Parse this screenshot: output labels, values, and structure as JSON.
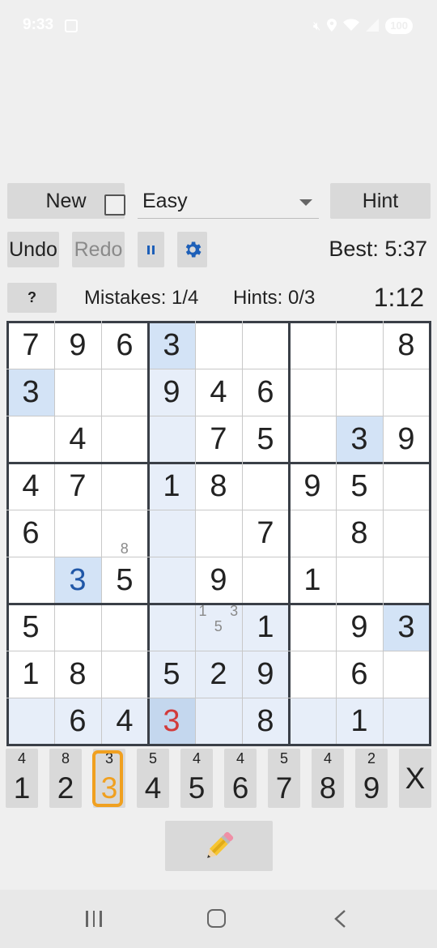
{
  "status_bar": {
    "time": "9:33",
    "battery": "100",
    "icons": [
      "screen-record-icon",
      "mute-icon",
      "location-icon",
      "wifi-icon",
      "signal-icon",
      "battery-icon"
    ]
  },
  "controls": {
    "new_label": "New",
    "difficulty": "Easy",
    "hint_label": "Hint",
    "undo_label": "Undo",
    "redo_label": "Redo",
    "best": "Best: 5:37",
    "help_label": "?",
    "mistakes": "Mistakes: 1/4",
    "hints": "Hints: 0/3",
    "timer": "1:12",
    "checkbox_checked": false
  },
  "board": {
    "values": [
      [
        "7",
        "9",
        "6",
        "3",
        "",
        "",
        "",
        "",
        "8"
      ],
      [
        "3",
        "",
        "",
        "9",
        "4",
        "6",
        "",
        "",
        ""
      ],
      [
        "",
        "4",
        "",
        "",
        "7",
        "5",
        "",
        "3",
        "9"
      ],
      [
        "4",
        "7",
        "",
        "1",
        "8",
        "",
        "9",
        "5",
        ""
      ],
      [
        "6",
        "",
        "",
        "",
        "",
        "7",
        "",
        "8",
        ""
      ],
      [
        "",
        "3",
        "5",
        "",
        "9",
        "",
        "1",
        "",
        ""
      ],
      [
        "5",
        "",
        "",
        "",
        "",
        "1",
        "",
        "9",
        "3"
      ],
      [
        "1",
        "8",
        "",
        "5",
        "2",
        "9",
        "",
        "6",
        ""
      ],
      [
        "",
        "6",
        "4",
        "3",
        "",
        "8",
        "",
        "1",
        ""
      ]
    ],
    "user_entries": [
      [
        5,
        1
      ]
    ],
    "error_entries": [
      [
        8,
        3
      ]
    ],
    "selected": [
      8,
      3
    ],
    "notes": [
      {
        "row": 4,
        "col": 2,
        "digits": [
          "8"
        ]
      },
      {
        "row": 6,
        "col": 4,
        "digits": [
          "1",
          "3",
          "5"
        ]
      }
    ]
  },
  "pad": {
    "keys": [
      {
        "digit": "1",
        "count": "4"
      },
      {
        "digit": "2",
        "count": "8"
      },
      {
        "digit": "3",
        "count": "3"
      },
      {
        "digit": "4",
        "count": "5"
      },
      {
        "digit": "5",
        "count": "4"
      },
      {
        "digit": "6",
        "count": "4"
      },
      {
        "digit": "7",
        "count": "5"
      },
      {
        "digit": "8",
        "count": "4"
      },
      {
        "digit": "9",
        "count": "2"
      }
    ],
    "active_digit": "3",
    "clear_label": "X"
  },
  "colors": {
    "background": "#efefef",
    "button": "#d9d9d9",
    "highlight": "#e7eef9",
    "same_value": "#d3e3f6",
    "user_digit": "#2057a7",
    "error_digit": "#d23a3a",
    "active_ring": "#f0a020"
  }
}
